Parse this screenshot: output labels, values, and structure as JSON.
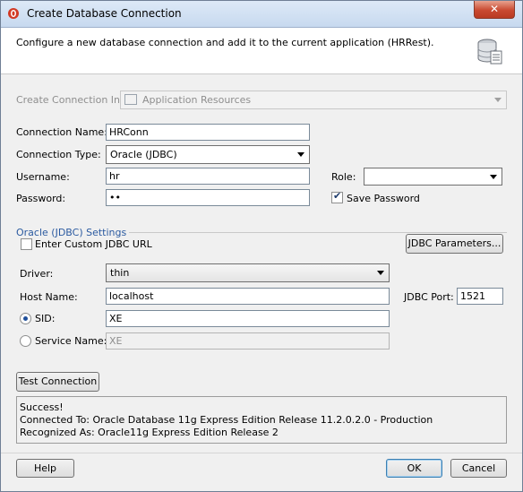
{
  "window": {
    "title": "Create Database Connection",
    "close_glyph": "✕"
  },
  "header": {
    "description": "Configure a new database connection and add it to the current application (HRRest).",
    "icon": "database-icon"
  },
  "form": {
    "create_in_label": "Create Connection In:",
    "create_in_value": "Application Resources",
    "connection_name_label": "Connection Name:",
    "connection_name_value": "HRConn",
    "connection_type_label": "Connection Type:",
    "connection_type_value": "Oracle (JDBC)",
    "username_label": "Username:",
    "username_value": "hr",
    "password_label": "Password:",
    "password_value": "••",
    "role_label": "Role:",
    "role_value": "",
    "save_password_label": "Save Password",
    "save_password_checked": true
  },
  "oracle_settings": {
    "section_title": "Oracle (JDBC) Settings",
    "custom_url_label": "Enter Custom JDBC URL",
    "custom_url_checked": false,
    "jdbc_params_button": "JDBC Parameters...",
    "driver_label": "Driver:",
    "driver_value": "thin",
    "host_label": "Host Name:",
    "host_value": "localhost",
    "port_label": "JDBC Port:",
    "port_value": "1521",
    "sid_label": "SID:",
    "sid_value": "XE",
    "sid_selected": true,
    "service_label": "Service Name:",
    "service_value": "XE"
  },
  "test": {
    "button_label": "Test Connection",
    "status_lines": [
      "Success!",
      "Connected To: Oracle Database 11g Express Edition Release 11.2.0.2.0 - Production",
      "Recognized As: Oracle11g Express Edition Release 2"
    ]
  },
  "footer": {
    "help_label": "Help",
    "ok_label": "OK",
    "cancel_label": "Cancel"
  },
  "colors": {
    "section_title": "#2b5aa0",
    "titlebar": "#c7d9ef",
    "close_button": "#c94a31"
  }
}
